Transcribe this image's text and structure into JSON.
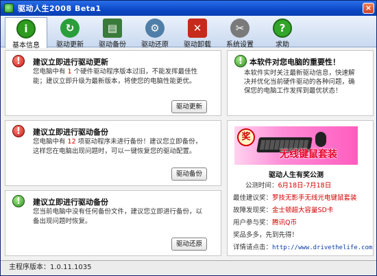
{
  "window": {
    "title": "驱动人生2008 Beta1",
    "close_label": "×"
  },
  "tabs": [
    {
      "label": "基本信息",
      "icon": "info-icon",
      "glyph": "i",
      "color": "#2e9a1f"
    },
    {
      "label": "驱动更新",
      "icon": "refresh-icon",
      "glyph": "↻",
      "color": "#2a9e3a"
    },
    {
      "label": "驱动备份",
      "icon": "floppy-icon",
      "glyph": "▤",
      "color": "#3a7a3a"
    },
    {
      "label": "驱动还原",
      "icon": "restore-gear-icon",
      "glyph": "⚙",
      "color": "#4f7fa8"
    },
    {
      "label": "驱动卸载",
      "icon": "uninstall-icon",
      "glyph": "✕",
      "color": "#c62a1a"
    },
    {
      "label": "系统设置",
      "icon": "tools-icon",
      "glyph": "✂",
      "color": "#7a7a7a"
    },
    {
      "label": "求助",
      "icon": "help-icon",
      "glyph": "?",
      "color": "#33a52a"
    }
  ],
  "panels": {
    "update": {
      "title": "建议立即进行驱动更新",
      "body_pre": "您电脑中有 ",
      "count": "1",
      "body_post": " 个硬件驱动程序版本过旧，不能发挥最佳性能；建议立即升级为最新版本，将使您的电脑性能更优。",
      "button": "驱动更新"
    },
    "backup": {
      "title": "建议立即进行驱动备份",
      "body_pre": "您电脑中有 ",
      "count": "12",
      "body_post": " 项驱动程序未进行备份！建议您立即备份，这样您在电脑出现问题时，可以一键恢复您的驱动配置。",
      "button": "驱动备份"
    },
    "restore": {
      "title": "建议立即进行驱动备份",
      "body": "您当前电脑中没有任何备份文件，建议您立即进行备份，以备出现问题时恢复。",
      "button": "驱动还原"
    },
    "importance": {
      "title": "本软件对您电脑的重要性！",
      "body": "本软件实时关注最新驱动信息，快速解决并优化当前硬件驱动的各种问题，确保您的电脑工作发挥到最优状态！"
    },
    "lottery": {
      "ad_stamp": "奖",
      "ad_text": "无线键鼠套装",
      "title": "驱动人生有奖公测",
      "rows": [
        {
          "k": "公测时间：",
          "v": "6月18日-7月18日"
        },
        {
          "k": "最佳建议奖：",
          "v": "罗技无影手无线光电键鼠套装"
        },
        {
          "k": "故障发现奖：",
          "v": "金士顿超大容量SD卡"
        },
        {
          "k": "用户参与奖：",
          "v": "腾讯Q币"
        },
        {
          "k": "奖品多多，先到先得！",
          "v": ""
        },
        {
          "k": "详情请点击：",
          "url": "http://www.drivethelife.com"
        }
      ]
    }
  },
  "statusbar": {
    "version_label": "主程序版本：1.0.11.1035"
  }
}
